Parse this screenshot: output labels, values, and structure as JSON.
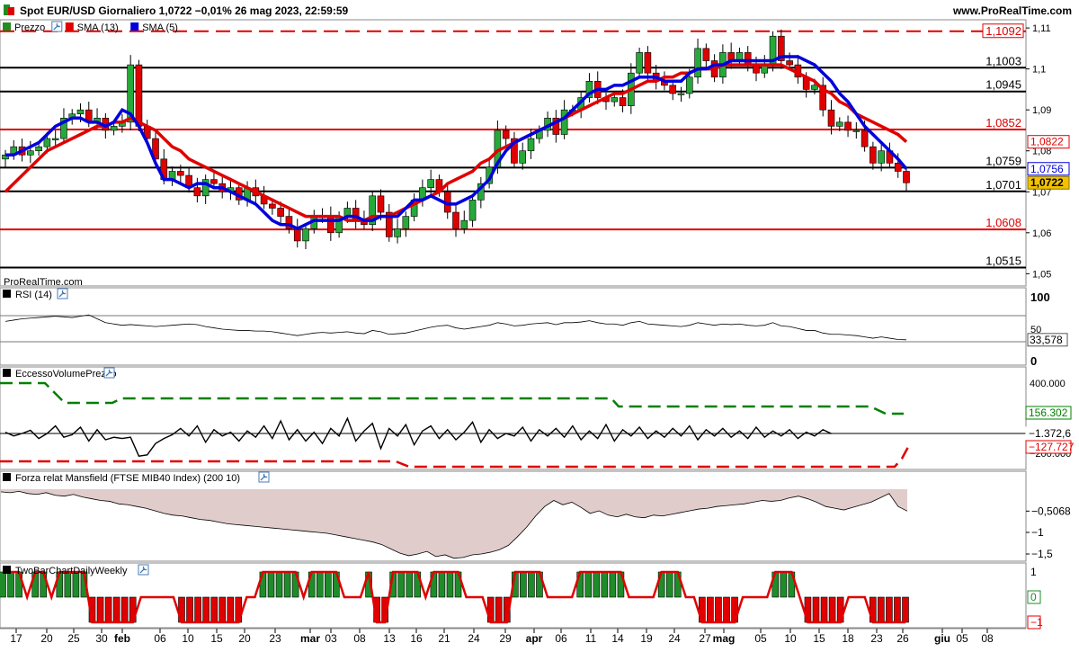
{
  "header": {
    "title": "Spot EUR/USD Giornaliero 1,0722 −0,01% 26 mag 2023, 22:59:59",
    "site": "www.ProRealTime.com"
  },
  "price_panel": {
    "legend": [
      {
        "label": "Prezzo",
        "color": "#228B22"
      },
      {
        "label": "SMA (13)",
        "color": "#e00000"
      },
      {
        "label": "SMA (5)",
        "color": "#0000dd"
      }
    ],
    "watermark": "ProRealTime.com",
    "levels": [
      {
        "label": "1,1092",
        "value": 1.1092,
        "color": "#e00000",
        "style": "dashed",
        "boxed": true
      },
      {
        "label": "1,1003",
        "value": 1.1003,
        "color": "#000000",
        "style": "solid"
      },
      {
        "label": "1,0945",
        "value": 1.0945,
        "color": "#000000",
        "style": "solid"
      },
      {
        "label": "1,0852",
        "value": 1.0852,
        "color": "#e00000",
        "style": "solid"
      },
      {
        "label": "1,0759",
        "value": 1.0759,
        "color": "#000000",
        "style": "solid"
      },
      {
        "label": "1,0701",
        "value": 1.0701,
        "color": "#000000",
        "style": "solid"
      },
      {
        "label": "1,0608",
        "value": 1.0608,
        "color": "#e00000",
        "style": "solid"
      },
      {
        "label": "1,0515",
        "value": 1.0515,
        "color": "#000000",
        "style": "solid"
      }
    ],
    "axis_ticks": [
      "1,11",
      "1,1",
      "1,09",
      "1,08",
      "1,07",
      "1,06",
      "1,05"
    ],
    "tags": [
      {
        "label": "1,0822",
        "value": 1.0822,
        "color": "#e00000",
        "bg": "#ffffff"
      },
      {
        "label": "1,0756",
        "value": 1.0756,
        "color": "#0000dd",
        "bg": "#ffffff"
      },
      {
        "label": "1,0722",
        "value": 1.0722,
        "color": "#000000",
        "bg": "#f2c200"
      }
    ]
  },
  "rsi_panel": {
    "title": "RSI (14)",
    "ticks": [
      "100",
      "50",
      "0"
    ],
    "value_label": "33,578"
  },
  "vol_panel": {
    "title": "EccessoVolumePrezzo",
    "ticks": [
      "400.000",
      "200.000",
      "−200.000"
    ],
    "tags": [
      {
        "label": "156.302",
        "color": "#008000"
      },
      {
        "label": "−1.372,6",
        "color": "#000000"
      },
      {
        "label": "−127.727",
        "color": "#e00000"
      }
    ]
  },
  "mansfield_panel": {
    "title": "Forza relat Mansfield (FTSE MIB40 Index) (200 10)",
    "ticks": [
      "−0,5068",
      "−1",
      "−1,5"
    ]
  },
  "twobar_panel": {
    "title": "TwoBarChartDailyWeekly",
    "ticks": [
      "1",
      "0",
      "−1"
    ]
  },
  "x_axis": {
    "labels": [
      {
        "text": "17",
        "bold": false
      },
      {
        "text": "20",
        "bold": false
      },
      {
        "text": "25",
        "bold": false
      },
      {
        "text": "30",
        "bold": false
      },
      {
        "text": "feb",
        "bold": true
      },
      {
        "text": "06",
        "bold": false
      },
      {
        "text": "10",
        "bold": false
      },
      {
        "text": "15",
        "bold": false
      },
      {
        "text": "20",
        "bold": false
      },
      {
        "text": "23",
        "bold": false
      },
      {
        "text": "mar",
        "bold": true
      },
      {
        "text": "03",
        "bold": false
      },
      {
        "text": "08",
        "bold": false
      },
      {
        "text": "13",
        "bold": false
      },
      {
        "text": "16",
        "bold": false
      },
      {
        "text": "21",
        "bold": false
      },
      {
        "text": "24",
        "bold": false
      },
      {
        "text": "29",
        "bold": false
      },
      {
        "text": "apr",
        "bold": true
      },
      {
        "text": "06",
        "bold": false
      },
      {
        "text": "11",
        "bold": false
      },
      {
        "text": "14",
        "bold": false
      },
      {
        "text": "19",
        "bold": false
      },
      {
        "text": "24",
        "bold": false
      },
      {
        "text": "27",
        "bold": false
      },
      {
        "text": "mag",
        "bold": true
      },
      {
        "text": "05",
        "bold": false
      },
      {
        "text": "10",
        "bold": false
      },
      {
        "text": "15",
        "bold": false
      },
      {
        "text": "18",
        "bold": false
      },
      {
        "text": "23",
        "bold": false
      },
      {
        "text": "26",
        "bold": false
      },
      {
        "text": "giu",
        "bold": true
      },
      {
        "text": "05",
        "bold": false
      },
      {
        "text": "08",
        "bold": false
      }
    ]
  },
  "chart_data": {
    "type": "candlestick",
    "title": "Spot EUR/USD Giornaliero",
    "ylim": [
      1.047,
      1.112
    ],
    "series": [
      {
        "name": "SMA (13)",
        "color": "#e00000"
      },
      {
        "name": "SMA (5)",
        "color": "#0000dd"
      }
    ],
    "closes": [
      1.079,
      1.081,
      1.079,
      1.08,
      1.081,
      1.083,
      1.083,
      1.088,
      1.089,
      1.09,
      1.087,
      1.088,
      1.085,
      1.086,
      1.087,
      1.101,
      1.086,
      1.083,
      1.078,
      1.073,
      1.075,
      1.074,
      1.071,
      1.069,
      1.073,
      1.072,
      1.07,
      1.071,
      1.068,
      1.071,
      1.069,
      1.067,
      1.066,
      1.064,
      1.061,
      1.058,
      1.061,
      1.064,
      1.064,
      1.06,
      1.064,
      1.066,
      1.063,
      1.062,
      1.069,
      1.065,
      1.059,
      1.061,
      1.064,
      1.068,
      1.071,
      1.073,
      1.07,
      1.065,
      1.061,
      1.063,
      1.068,
      1.072,
      1.076,
      1.085,
      1.083,
      1.077,
      1.08,
      1.083,
      1.085,
      1.088,
      1.084,
      1.09,
      1.09,
      1.093,
      1.097,
      1.093,
      1.092,
      1.093,
      1.091,
      1.099,
      1.104,
      1.099,
      1.097,
      1.096,
      1.094,
      1.094,
      1.098,
      1.105,
      1.102,
      1.098,
      1.104,
      1.102,
      1.104,
      1.101,
      1.099,
      1.101,
      1.108,
      1.102,
      1.101,
      1.098,
      1.095,
      1.096,
      1.09,
      1.086,
      1.087,
      1.085,
      1.085,
      1.081,
      1.077,
      1.08,
      1.077,
      1.075,
      1.0722
    ],
    "sma13": [
      1.07,
      1.072,
      1.074,
      1.076,
      1.078,
      1.08,
      1.081,
      1.082,
      1.083,
      1.084,
      1.085,
      1.086,
      1.086,
      1.087,
      1.087,
      1.088,
      1.087,
      1.086,
      1.085,
      1.083,
      1.081,
      1.08,
      1.078,
      1.077,
      1.076,
      1.075,
      1.074,
      1.073,
      1.072,
      1.071,
      1.07,
      1.069,
      1.068,
      1.067,
      1.066,
      1.065,
      1.064,
      1.064,
      1.064,
      1.064,
      1.064,
      1.063,
      1.063,
      1.063,
      1.064,
      1.064,
      1.064,
      1.065,
      1.066,
      1.067,
      1.068,
      1.069,
      1.07,
      1.072,
      1.073,
      1.074,
      1.075,
      1.077,
      1.078,
      1.08,
      1.081,
      1.082,
      1.083,
      1.084,
      1.085,
      1.086,
      1.087,
      1.088,
      1.089,
      1.09,
      1.091,
      1.092,
      1.093,
      1.094,
      1.094,
      1.095,
      1.096,
      1.097,
      1.097,
      1.098,
      1.098,
      1.099,
      1.099,
      1.1,
      1.1,
      1.1,
      1.101,
      1.101,
      1.101,
      1.101,
      1.101,
      1.101,
      1.101,
      1.101,
      1.1,
      1.099,
      1.098,
      1.097,
      1.095,
      1.094,
      1.092,
      1.091,
      1.089,
      1.088,
      1.087,
      1.086,
      1.085,
      1.084,
      1.0822
    ],
    "sma5": [
      1.079,
      1.079,
      1.08,
      1.081,
      1.082,
      1.084,
      1.086,
      1.087,
      1.088,
      1.088,
      1.087,
      1.087,
      1.086,
      1.087,
      1.09,
      1.089,
      1.086,
      1.082,
      1.077,
      1.073,
      1.073,
      1.072,
      1.071,
      1.072,
      1.072,
      1.071,
      1.071,
      1.07,
      1.069,
      1.068,
      1.067,
      1.065,
      1.063,
      1.062,
      1.062,
      1.061,
      1.062,
      1.063,
      1.063,
      1.063,
      1.063,
      1.064,
      1.064,
      1.063,
      1.063,
      1.064,
      1.064,
      1.064,
      1.066,
      1.068,
      1.068,
      1.069,
      1.068,
      1.067,
      1.067,
      1.068,
      1.069,
      1.071,
      1.073,
      1.077,
      1.08,
      1.082,
      1.083,
      1.084,
      1.085,
      1.086,
      1.087,
      1.088,
      1.09,
      1.092,
      1.094,
      1.095,
      1.095,
      1.096,
      1.096,
      1.097,
      1.098,
      1.098,
      1.098,
      1.097,
      1.097,
      1.097,
      1.099,
      1.1,
      1.1,
      1.101,
      1.101,
      1.102,
      1.102,
      1.102,
      1.102,
      1.102,
      1.102,
      1.103,
      1.103,
      1.103,
      1.102,
      1.101,
      1.099,
      1.097,
      1.094,
      1.092,
      1.089,
      1.086,
      1.084,
      1.082,
      1.08,
      1.078,
      1.0756
    ],
    "rsi": [
      62,
      64,
      66,
      67,
      68,
      69,
      70,
      69,
      68,
      70,
      72,
      66,
      60,
      58,
      56,
      57,
      56,
      55,
      54,
      55,
      56,
      57,
      58,
      57,
      54,
      52,
      50,
      49,
      48,
      48,
      47,
      47,
      46,
      44,
      42,
      40,
      42,
      44,
      45,
      44,
      45,
      46,
      44,
      43,
      48,
      46,
      42,
      43,
      44,
      47,
      50,
      53,
      55,
      56,
      52,
      50,
      52,
      54,
      56,
      60,
      58,
      55,
      56,
      58,
      59,
      60,
      57,
      60,
      60,
      61,
      63,
      60,
      58,
      58,
      56,
      60,
      62,
      58,
      57,
      56,
      55,
      54,
      56,
      60,
      58,
      56,
      58,
      57,
      58,
      56,
      55,
      56,
      60,
      55,
      54,
      51,
      48,
      48,
      44,
      42,
      42,
      41,
      40,
      38,
      36,
      38,
      36,
      34,
      33.578
    ],
    "volume_osc": [
      10,
      -20,
      0,
      25,
      -40,
      0,
      60,
      -30,
      -10,
      50,
      -60,
      30,
      -50,
      -30,
      -40,
      -30,
      -180,
      -170,
      -80,
      -40,
      -10,
      40,
      -20,
      60,
      -70,
      30,
      -20,
      10,
      -60,
      20,
      -30,
      60,
      -40,
      100,
      -50,
      30,
      -60,
      10,
      -80,
      40,
      -20,
      120,
      -60,
      20,
      80,
      -120,
      40,
      -20,
      70,
      -90,
      20,
      60,
      -40,
      30,
      -50,
      10,
      90,
      -70,
      30,
      -40,
      0,
      -20,
      50,
      -60,
      30,
      -20,
      40,
      -30,
      60,
      -50,
      20,
      -40,
      70,
      -60,
      30,
      -20,
      50,
      -40,
      20,
      -30,
      40,
      -20,
      60,
      -50,
      30,
      -20,
      40,
      -30,
      20,
      -40,
      50,
      -30,
      20,
      -20,
      30,
      -40,
      10,
      -20,
      30,
      -1.3726
    ],
    "mansfield": [
      -0.06,
      -0.08,
      -0.05,
      -0.1,
      -0.12,
      -0.08,
      -0.14,
      -0.16,
      -0.12,
      -0.18,
      -0.22,
      -0.26,
      -0.28,
      -0.34,
      -0.36,
      -0.4,
      -0.44,
      -0.5,
      -0.56,
      -0.6,
      -0.62,
      -0.66,
      -0.7,
      -0.72,
      -0.76,
      -0.8,
      -0.82,
      -0.84,
      -0.86,
      -0.88,
      -0.9,
      -0.92,
      -0.94,
      -0.96,
      -0.98,
      -1.0,
      -1.02,
      -1.06,
      -1.1,
      -1.14,
      -1.18,
      -1.22,
      -1.28,
      -1.38,
      -1.48,
      -1.54,
      -1.5,
      -1.44,
      -1.56,
      -1.52,
      -1.6,
      -1.58,
      -1.52,
      -1.5,
      -1.46,
      -1.4,
      -1.3,
      -1.1,
      -0.88,
      -0.62,
      -0.4,
      -0.26,
      -0.36,
      -0.3,
      -0.42,
      -0.56,
      -0.5,
      -0.6,
      -0.64,
      -0.58,
      -0.64,
      -0.66,
      -0.6,
      -0.62,
      -0.58,
      -0.54,
      -0.5,
      -0.46,
      -0.44,
      -0.4,
      -0.38,
      -0.36,
      -0.34,
      -0.3,
      -0.26,
      -0.28,
      -0.26,
      -0.2,
      -0.16,
      -0.22,
      -0.3,
      -0.4,
      -0.44,
      -0.48,
      -0.42,
      -0.36,
      -0.3,
      -0.2,
      -0.1,
      -0.4,
      -0.5068
    ],
    "twobar": [
      1,
      1,
      1,
      0,
      1,
      1,
      0,
      1,
      1,
      1,
      1,
      -1,
      -1,
      -1,
      -1,
      -1,
      -1,
      0,
      0,
      0,
      0,
      0,
      -1,
      -1,
      -1,
      -1,
      -1,
      -1,
      -1,
      -1,
      0,
      0,
      1,
      1,
      1,
      1,
      1,
      0,
      1,
      1,
      1,
      1,
      0,
      0,
      0,
      1,
      -1,
      -1,
      1,
      1,
      1,
      1,
      0,
      1,
      1,
      1,
      1,
      0,
      0,
      0,
      -1,
      -1,
      -1,
      1,
      1,
      1,
      1,
      0,
      0,
      0,
      0,
      1,
      1,
      1,
      1,
      1,
      1,
      0,
      0,
      0,
      0,
      1,
      1,
      1,
      0,
      0,
      -1,
      -1,
      -1,
      -1,
      -1,
      0,
      0,
      0,
      0,
      1,
      1,
      1,
      0,
      -1,
      -1,
      -1,
      -1,
      -1,
      0,
      0,
      0,
      -1,
      -1,
      -1,
      -1,
      -1
    ]
  }
}
